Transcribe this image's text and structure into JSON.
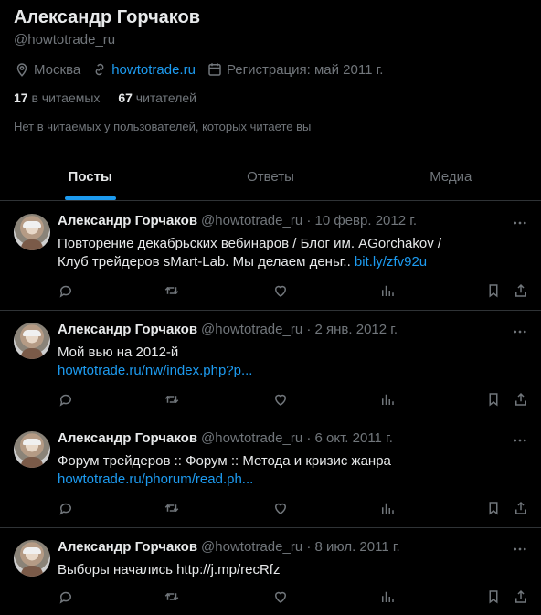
{
  "profile": {
    "name": "Александр Горчаков",
    "handle": "@howtotrade_ru",
    "location": "Москва",
    "website": "howtotrade.ru",
    "joined": "Регистрация: май 2011 г.",
    "following_count": "17",
    "following_label": "в читаемых",
    "followers_count": "67",
    "followers_label": "читателей",
    "followed_by_note": "Нет в читаемых у пользователей, которых читаете вы"
  },
  "tabs": [
    {
      "label": "Посты",
      "active": true
    },
    {
      "label": "Ответы",
      "active": false
    },
    {
      "label": "Медиа",
      "active": false
    }
  ],
  "tweets": [
    {
      "name": "Александр Горчаков",
      "handle": "@howtotrade_ru",
      "date": "· 10 февр. 2012 г.",
      "text": "Повторение декабрьских вебинаров / Блог им. AGorchakov / Клуб трейдеров sMart-Lab. Мы делаем деньг..",
      "link": "bit.ly/zfv92u"
    },
    {
      "name": "Александр Горчаков",
      "handle": "@howtotrade_ru",
      "date": "· 2 янв. 2012 г.",
      "text": "Мой вью на 2012-й",
      "link": "howtotrade.ru/nw/index.php?p..."
    },
    {
      "name": "Александр Горчаков",
      "handle": "@howtotrade_ru",
      "date": "· 6 окт. 2011 г.",
      "text": "Форум трейдеров :: Форум :: Метода и кризис жанра",
      "link": "howtotrade.ru/phorum/read.ph..."
    },
    {
      "name": "Александр Горчаков",
      "handle": "@howtotrade_ru",
      "date": "· 8 июл. 2011 г.",
      "text": "Выборы начались http://j.mp/recRfz",
      "link": ""
    }
  ],
  "colors": {
    "background": "#000000",
    "accent": "#1d9bf0",
    "text": "#e7e9ea",
    "muted": "#71767b",
    "border": "#2f3336"
  },
  "icons": [
    "location-icon",
    "link-icon",
    "calendar-icon",
    "more-icon",
    "reply-icon",
    "retweet-icon",
    "like-icon",
    "views-icon",
    "bookmark-icon",
    "share-icon"
  ]
}
